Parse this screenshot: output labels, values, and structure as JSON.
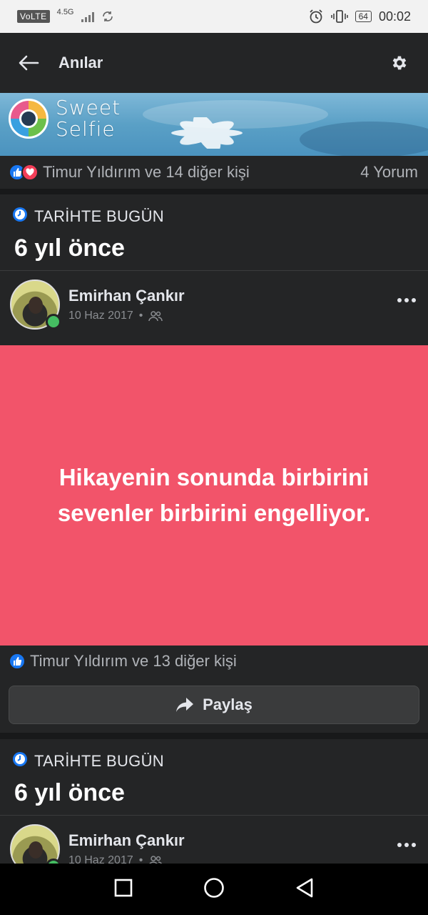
{
  "status_bar": {
    "volte": "VoLTE",
    "network": "4.5G",
    "battery": "64",
    "time": "00:02"
  },
  "app_bar": {
    "title": "Anılar"
  },
  "banner": {
    "brand_line1": "Sweet",
    "brand_line2": "Selfie"
  },
  "top_post_stats": {
    "reactions_text": "Timur Yıldırım ve 14 diğer kişi",
    "comments_text": "4 Yorum"
  },
  "memories": [
    {
      "label": "TARİHTE BUGÜN",
      "title": "6 yıl önce",
      "author": "Emirhan Çankır",
      "date": "10 Haz 2017",
      "separator": "•",
      "status_text": "Hikayenin sonunda birbirini sevenler birbirini engelliyor.",
      "likes_text": "Timur Yıldırım ve 13 diğer kişi",
      "share_label": "Paylaş"
    },
    {
      "label": "TARİHTE BUGÜN",
      "title": "6 yıl önce",
      "author": "Emirhan Çankır",
      "date": "10 Haz 2017",
      "separator": "•"
    }
  ],
  "colors": {
    "status_background": "#f2546a",
    "like_blue": "#1877f2",
    "love_red": "#f33e58",
    "online_green": "#45bd62"
  },
  "icons": {
    "back": "arrow-left-icon",
    "settings": "gear-icon",
    "memory": "clock-icon",
    "audience": "friends-icon",
    "more": "more-horizontal-icon",
    "share": "share-arrow-icon",
    "nav_recents": "square-icon",
    "nav_home": "circle-icon",
    "nav_back": "triangle-back-icon"
  }
}
